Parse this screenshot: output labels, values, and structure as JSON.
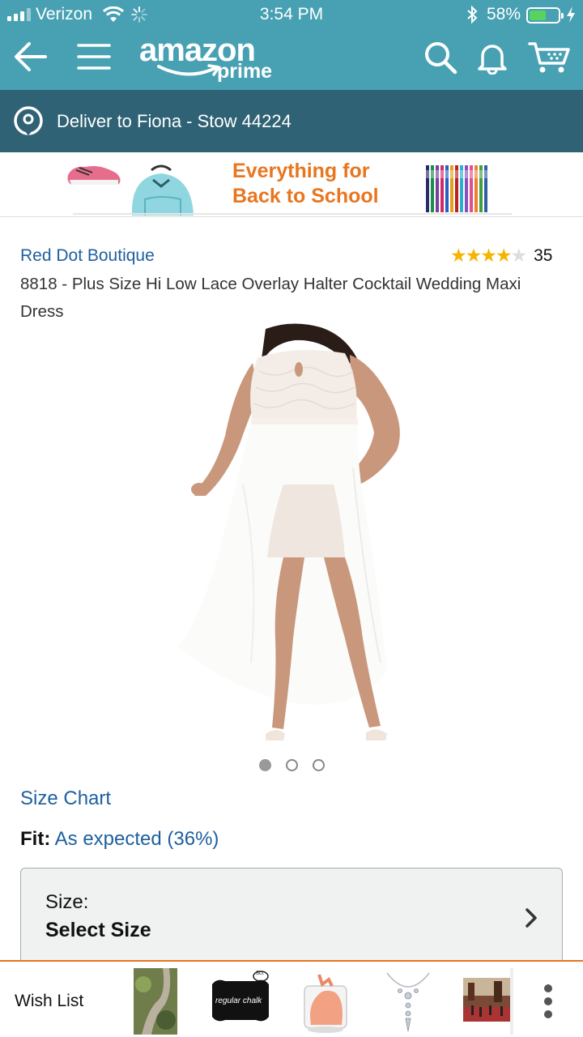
{
  "status_bar": {
    "carrier": "Verizon",
    "time": "3:54 PM",
    "battery_percent": "58%",
    "battery_level": 0.58
  },
  "header": {
    "logo_word": "amazon",
    "logo_sub": "prime",
    "icons": [
      "back-arrow-icon",
      "hamburger-menu-icon",
      "search-icon",
      "bell-icon",
      "cart-icon"
    ]
  },
  "delivery": {
    "text": "Deliver to Fiona - Stow 44224"
  },
  "banner": {
    "line1": "Everything for",
    "line2": "Back to School"
  },
  "product": {
    "brand": "Red Dot Boutique",
    "rating_stars": 4,
    "rating_count": "35",
    "title": "8818 - Plus Size Hi Low Lace Overlay Halter Cocktail Wedding Maxi Dress",
    "image_count": 3,
    "active_image": 0
  },
  "size_chart": "Size Chart",
  "fit": {
    "label": "Fit:",
    "value": "As expected (36%)"
  },
  "size_selector": {
    "label": "Size:",
    "value": "Select Size"
  },
  "bottom_bar": {
    "wish_list": "Wish List",
    "thumb_chalk_text": "regular chalk",
    "thumb_chalk_badge": "3ct"
  },
  "colors": {
    "header_bg": "#48a1b3",
    "deliver_bg": "#2f6274",
    "link": "#1f5f9e",
    "accent_orange": "#e8761f",
    "star": "#f4b400"
  }
}
